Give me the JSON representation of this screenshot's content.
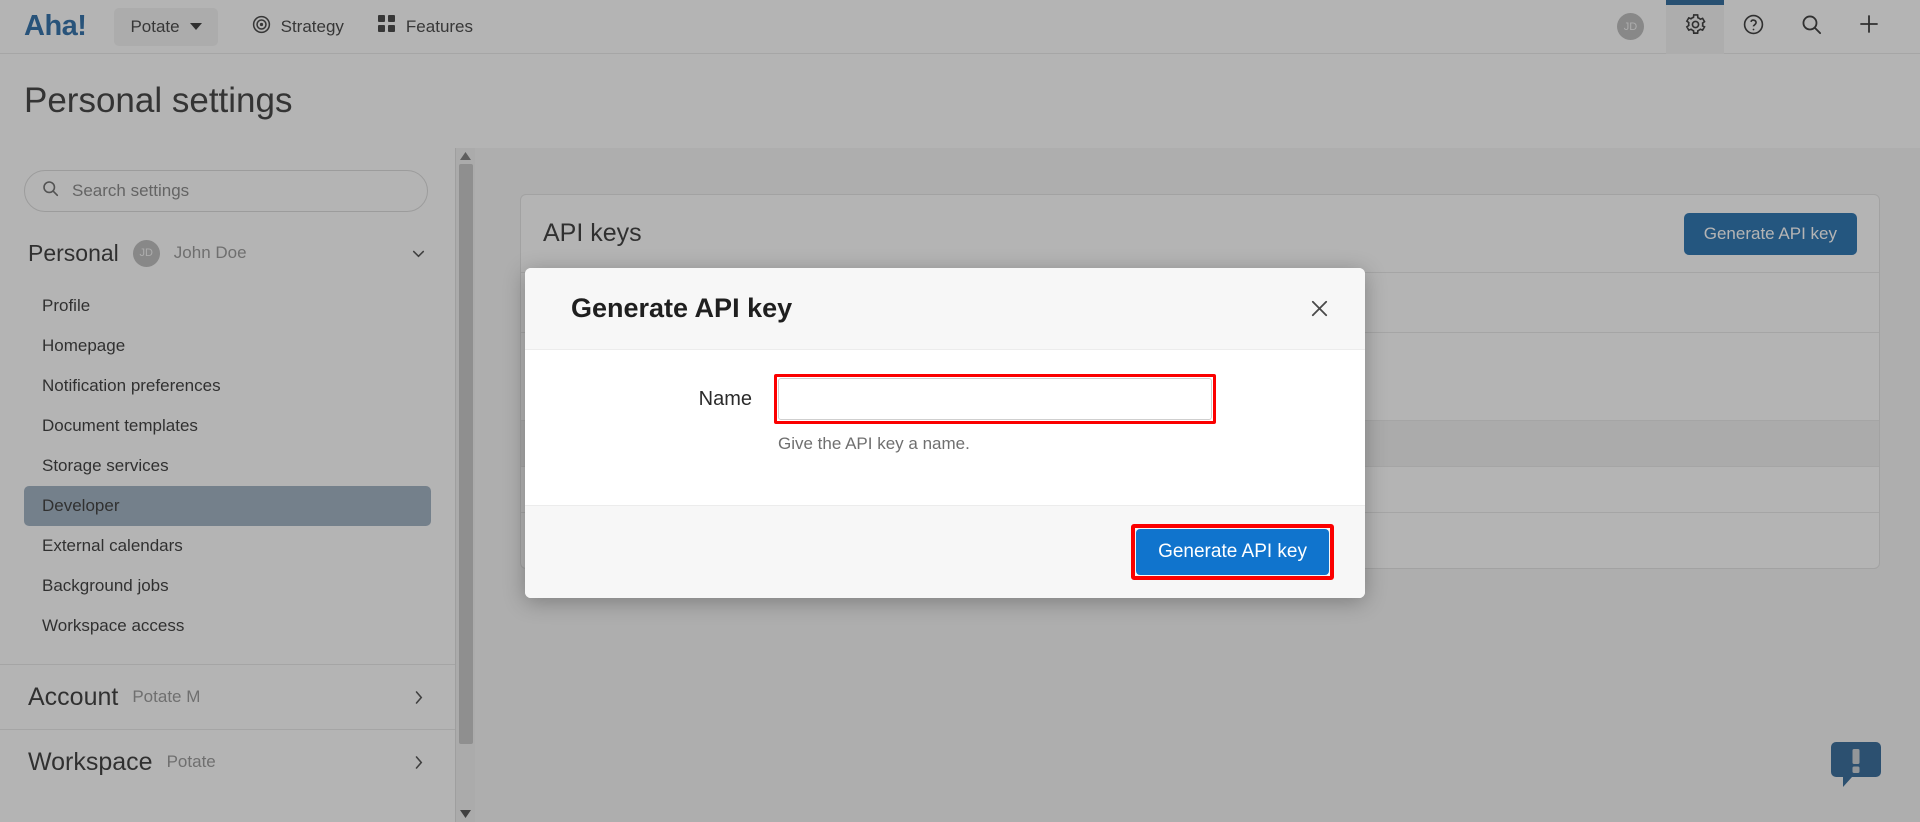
{
  "topnav": {
    "logo_text": "Aha!",
    "workspace_switcher": {
      "label": "Potate",
      "icon": "caret-down-icon"
    },
    "items": [
      {
        "label": "Strategy",
        "icon": "target-icon"
      },
      {
        "label": "Features",
        "icon": "grid-icon"
      }
    ],
    "avatar_initials": "JD",
    "right_icons": [
      {
        "name": "gear-icon",
        "active": true
      },
      {
        "name": "question-circle-icon",
        "active": false
      },
      {
        "name": "search-icon",
        "active": false
      },
      {
        "name": "plus-icon",
        "active": false
      }
    ]
  },
  "page": {
    "title": "Personal settings"
  },
  "sidebar": {
    "search": {
      "placeholder": "Search settings",
      "value": "",
      "icon": "search-icon"
    },
    "personal_group": {
      "name": "Personal",
      "avatar_initials": "JD",
      "user_name": "John Doe",
      "chevron": "chevron-down-icon"
    },
    "items": [
      {
        "label": "Profile",
        "selected": false
      },
      {
        "label": "Homepage",
        "selected": false
      },
      {
        "label": "Notification preferences",
        "selected": false
      },
      {
        "label": "Document templates",
        "selected": false
      },
      {
        "label": "Storage services",
        "selected": false
      },
      {
        "label": "Developer",
        "selected": true
      },
      {
        "label": "External calendars",
        "selected": false
      },
      {
        "label": "Background jobs",
        "selected": false
      },
      {
        "label": "Workspace access",
        "selected": false
      }
    ],
    "account_group": {
      "name": "Account",
      "sub": "Potate M",
      "chevron": "chevron-right-icon"
    },
    "workspace_group": {
      "name": "Workspace",
      "sub": "Potate",
      "chevron": "chevron-right-icon"
    }
  },
  "main": {
    "card": {
      "title": "API keys",
      "generate_button": "Generate API key"
    },
    "help_bubble": {
      "icon": "alert-bubble-icon"
    }
  },
  "modal": {
    "title": "Generate API key",
    "close_icon": "close-icon",
    "name_label": "Name",
    "name_value": "",
    "name_placeholder": "",
    "name_help": "Give the API key a name.",
    "submit_button": "Generate API key"
  },
  "colors": {
    "brand_blue": "#125a9c",
    "primary_button": "#0b5fa5",
    "modal_button": "#1074cd",
    "highlight_red": "#fb0000",
    "selected_nav": "#93a7b9",
    "dim_overlay": "rgba(74,74,74,0.41)"
  }
}
